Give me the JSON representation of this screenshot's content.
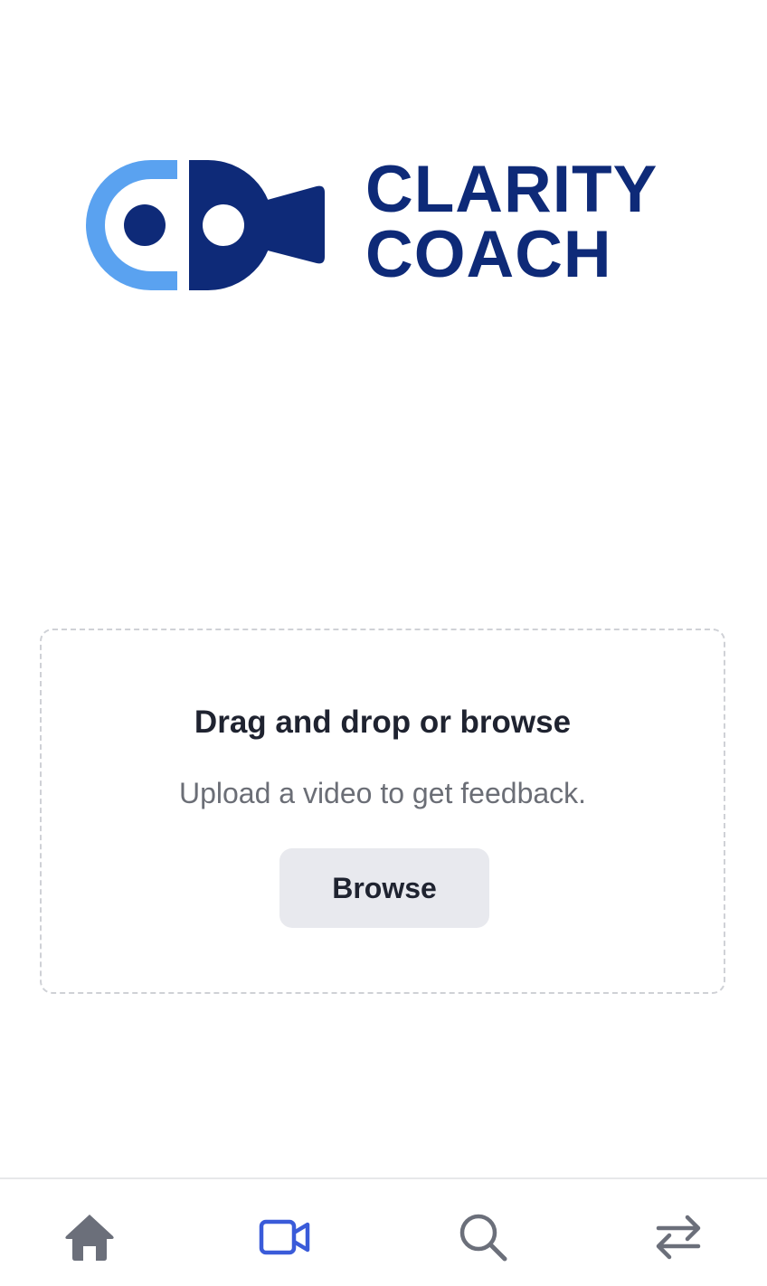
{
  "logo": {
    "line1": "CLARITY",
    "line2": "COACH",
    "colors": {
      "light": "#5aa2f0",
      "dark": "#0e2a78"
    }
  },
  "upload": {
    "title": "Drag and drop or browse",
    "subtitle": "Upload a video to get feedback.",
    "button_label": "Browse"
  },
  "tabbar": {
    "items": [
      {
        "icon": "home-icon",
        "active": false
      },
      {
        "icon": "video-camera-icon",
        "active": true
      },
      {
        "icon": "search-icon",
        "active": false
      },
      {
        "icon": "swap-arrows-icon",
        "active": false
      }
    ],
    "active_color": "#3a5bd9",
    "inactive_color": "#6b6f7a"
  }
}
